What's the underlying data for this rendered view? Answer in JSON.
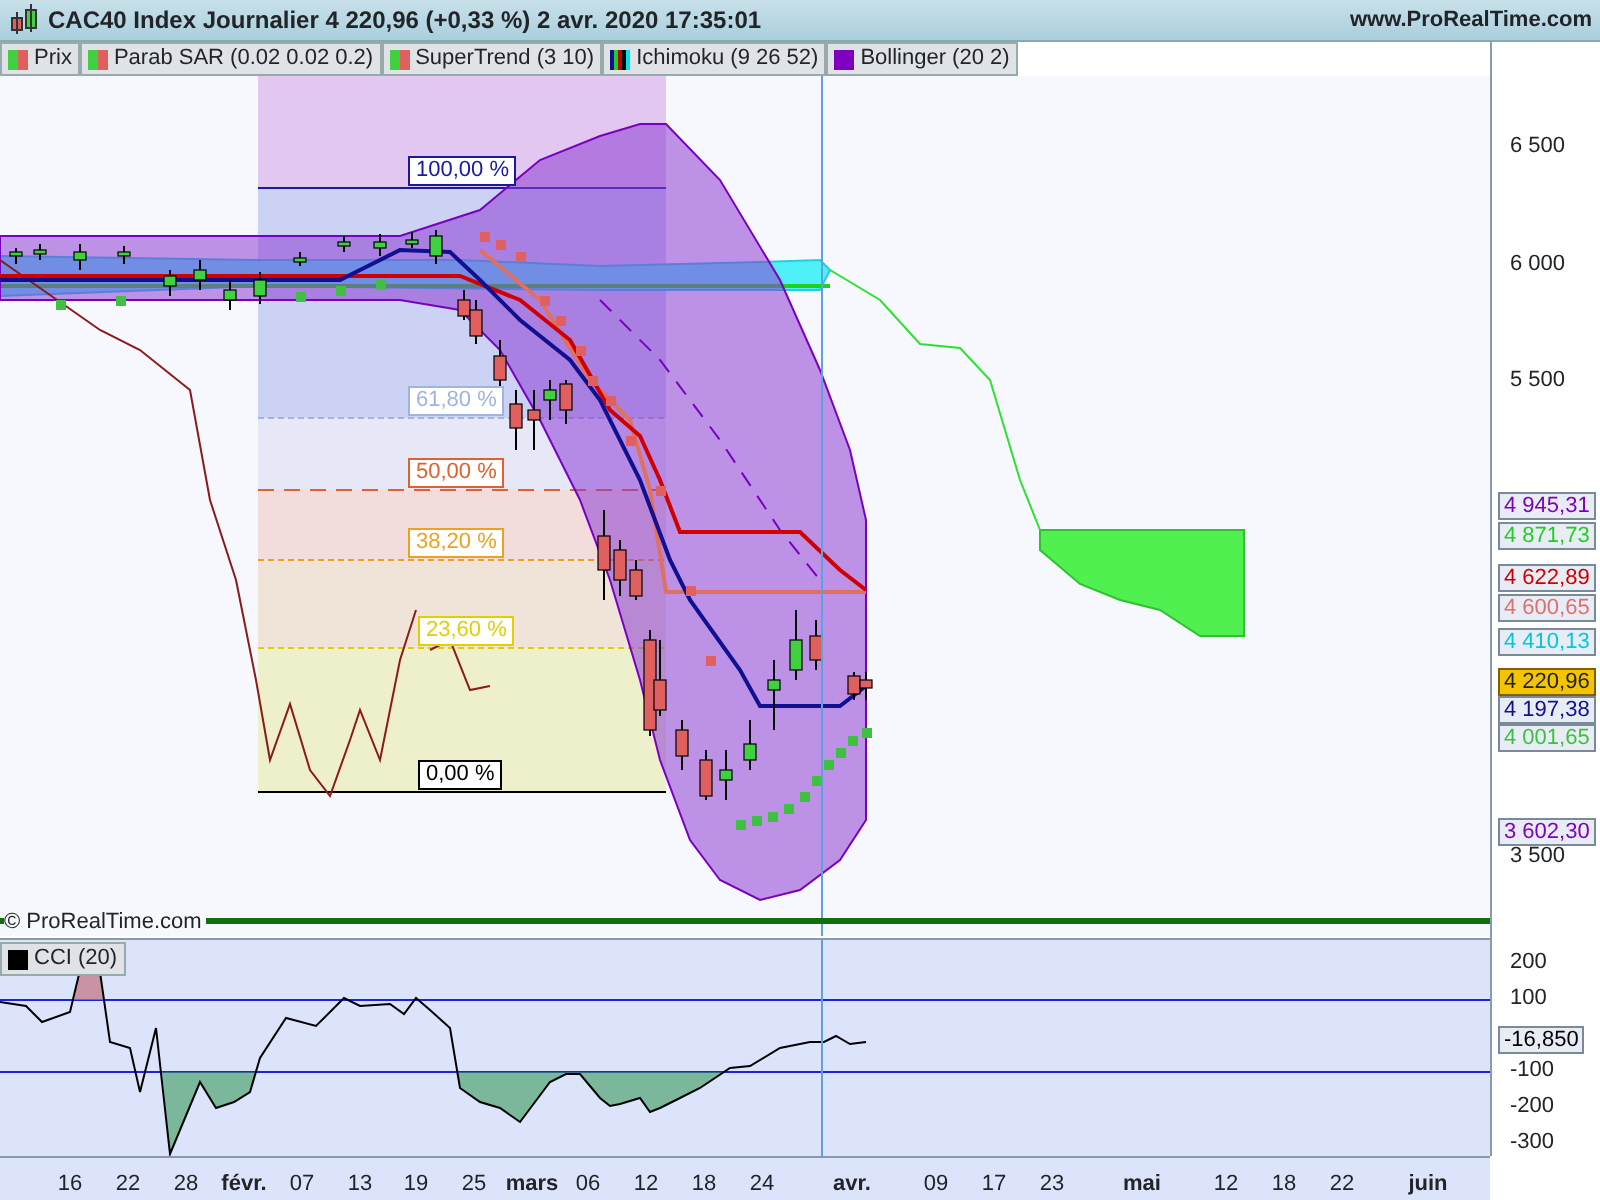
{
  "title_bar": {
    "title": "CAC40 Index Journalier 4 220,96 (+0,33 %) 2 avr. 2020 17:35:01",
    "site": "www.ProRealTime.com"
  },
  "legend": [
    {
      "label": "Prix",
      "kind": "price"
    },
    {
      "label": "Parab SAR (0.02 0.02 0.2)",
      "kind": "sar"
    },
    {
      "label": "SuperTrend (3 10)",
      "kind": "supertrend"
    },
    {
      "label": "Ichimoku (9 26 52)",
      "kind": "ichimoku"
    },
    {
      "label": "Bollinger (20 2)",
      "kind": "bollinger"
    }
  ],
  "fibonacci": [
    {
      "label": "100,00 %",
      "color": "#1a1aa0"
    },
    {
      "label": "61,80 %",
      "color": "#a0b4e0"
    },
    {
      "label": "50,00 %",
      "color": "#e06030"
    },
    {
      "label": "38,20 %",
      "color": "#f0a020"
    },
    {
      "label": "23,60 %",
      "color": "#e0d000"
    },
    {
      "label": "0,00 %",
      "color": "#000000"
    }
  ],
  "price_axis": {
    "ticks": [
      "6 500",
      "6 000",
      "5 500",
      "3 500"
    ]
  },
  "price_tags": [
    {
      "value": "4 945,31",
      "color": "#8000c0",
      "highlighted": false
    },
    {
      "value": "4 871,73",
      "color": "#20d020",
      "highlighted": false
    },
    {
      "value": "4 622,89",
      "color": "#d00000",
      "highlighted": false
    },
    {
      "value": "4 600,65",
      "color": "#e07070",
      "highlighted": false
    },
    {
      "value": "4 410,13",
      "color": "#00c8e0",
      "highlighted": false
    },
    {
      "value": "4 220,96",
      "highlighted": true
    },
    {
      "value": "4 197,38",
      "color": "#101090",
      "highlighted": false
    },
    {
      "value": "4 001,65",
      "color": "#40c040",
      "highlighted": false
    },
    {
      "value": "3 602,30",
      "color": "#8000c0",
      "highlighted": false
    }
  ],
  "copyright": "© ProRealTime.com",
  "cci": {
    "label": "CCI (20)",
    "ticks": [
      "200",
      "100",
      "-100",
      "-200",
      "-300"
    ],
    "value_tag": "-16,850"
  },
  "date_axis": [
    {
      "label": "16",
      "month": false
    },
    {
      "label": "22",
      "month": false
    },
    {
      "label": "28",
      "month": false
    },
    {
      "label": "févr.",
      "month": true
    },
    {
      "label": "07",
      "month": false
    },
    {
      "label": "13",
      "month": false
    },
    {
      "label": "19",
      "month": false
    },
    {
      "label": "25",
      "month": false
    },
    {
      "label": "mars",
      "month": true
    },
    {
      "label": "06",
      "month": false
    },
    {
      "label": "12",
      "month": false
    },
    {
      "label": "18",
      "month": false
    },
    {
      "label": "24",
      "month": false
    },
    {
      "label": "avr.",
      "month": true
    },
    {
      "label": "09",
      "month": false
    },
    {
      "label": "17",
      "month": false
    },
    {
      "label": "23",
      "month": false
    },
    {
      "label": "mai",
      "month": true
    },
    {
      "label": "12",
      "month": false
    },
    {
      "label": "18",
      "month": false
    },
    {
      "label": "22",
      "month": false
    },
    {
      "label": "juin",
      "month": true
    }
  ]
}
